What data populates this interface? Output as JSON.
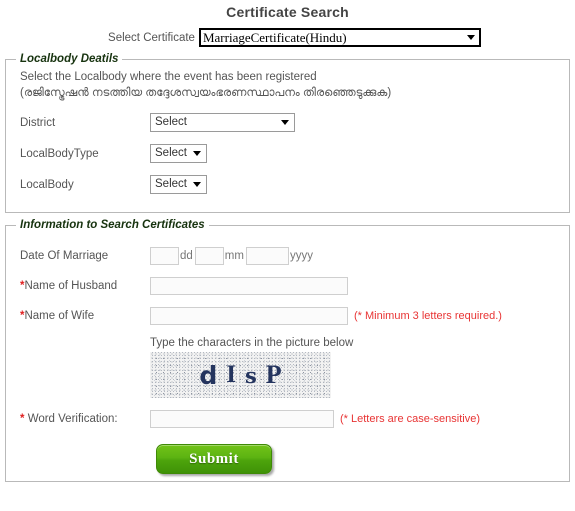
{
  "page": {
    "title": "Certificate Search"
  },
  "certificate_select": {
    "label": "Select Certificate",
    "value": "MarriageCertificate(Hindu)",
    "caret_icon": "chevron-down-icon"
  },
  "localbody": {
    "legend": "Localbody Deatils",
    "helper_en": "Select the Localbody where the event has been registered",
    "helper_ml": "(രജിസ്ട്രേഷൻ നടത്തിയ തദ്ദേശസ്വയംഭരണസ്ഥാപനം തിരഞ്ഞെടുക്കുക)",
    "fields": {
      "district": {
        "label": "District",
        "value": "Select"
      },
      "localbodytype": {
        "label": "LocalBodyType",
        "value": "Select"
      },
      "localbody": {
        "label": "LocalBody",
        "value": "Select"
      }
    }
  },
  "search_info": {
    "legend": "Information to Search Certificates",
    "date_of_marriage": {
      "label": "Date Of Marriage",
      "day_value": "",
      "day_suffix": "dd",
      "month_value": "",
      "month_suffix": "mm",
      "year_value": "",
      "year_suffix": "yyyy"
    },
    "husband": {
      "label_star": "*",
      "label": "Name of Husband",
      "value": ""
    },
    "wife": {
      "label_star": "*",
      "label": "Name of Wife",
      "value": "",
      "note": "(* Minimum 3 letters required.)"
    },
    "captcha": {
      "caption": "Type the characters in the picture below",
      "characters": [
        "d",
        "I",
        "s",
        "P"
      ],
      "text": "dIsP"
    },
    "word_verification": {
      "label_star": "*",
      "label": "Word Verification:",
      "value": "",
      "note": "(* Letters are case-sensitive)"
    },
    "submit_label": "Submit"
  },
  "colors": {
    "legend": "#17330f",
    "required_star": "#e02020",
    "note_red": "#e83434",
    "submit_green": "#5cb312",
    "captcha_text": "#24345e"
  }
}
